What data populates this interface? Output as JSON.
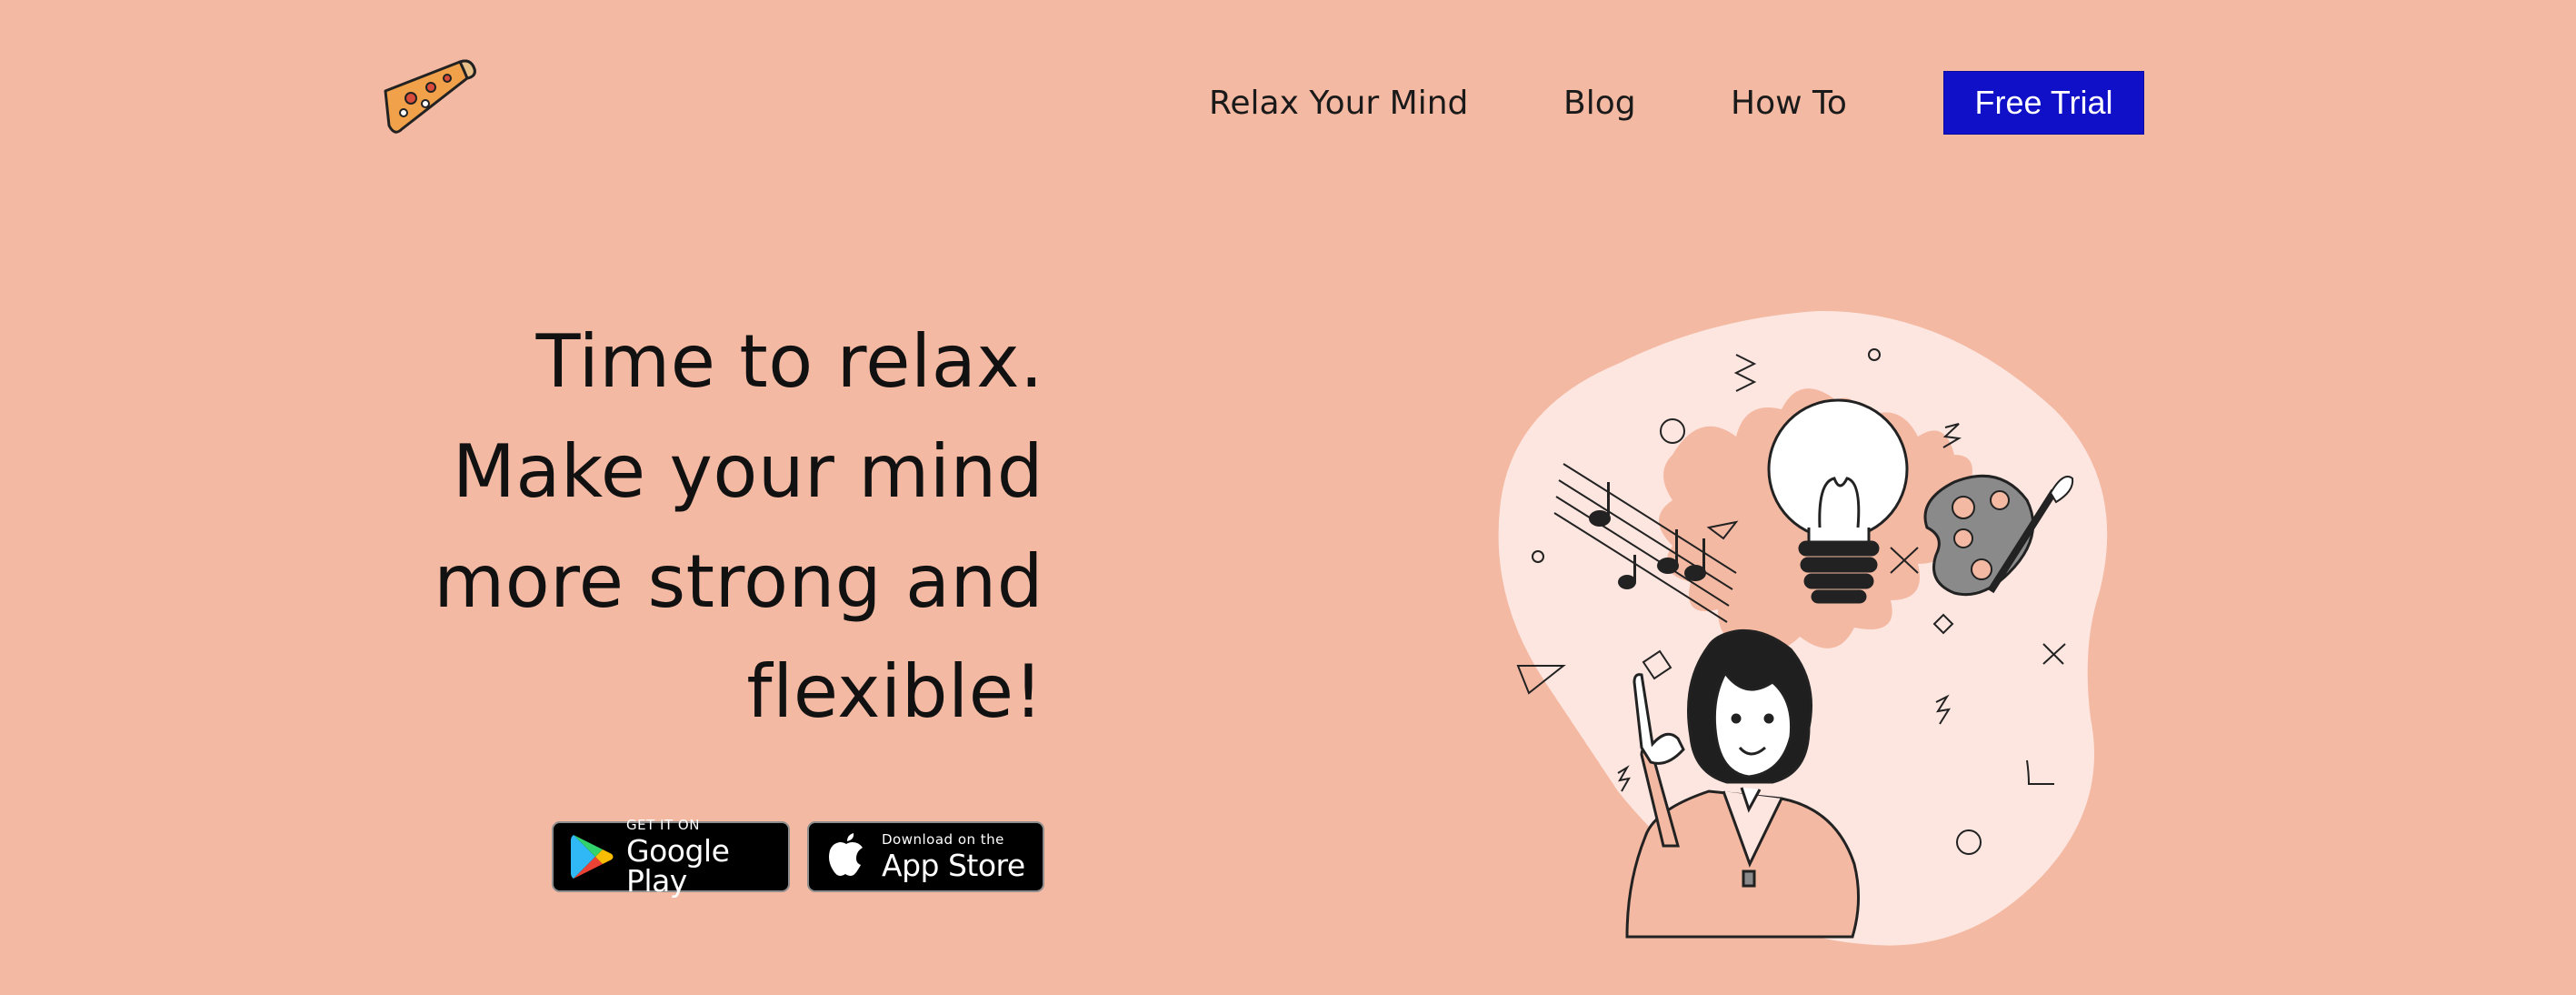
{
  "header": {
    "logo_icon": "pizza-slice-icon",
    "nav": [
      {
        "label": "Relax Your Mind"
      },
      {
        "label": "Blog"
      },
      {
        "label": "How To"
      }
    ],
    "cta_label": "Free Trial"
  },
  "hero": {
    "title_lines": [
      "Time to relax.",
      "Make your mind",
      "more strong and",
      "flexible!"
    ],
    "stores": {
      "google_play": {
        "small": "GET IT ON",
        "big": "Google Play"
      },
      "app_store": {
        "small": "Download on the",
        "big": "App Store"
      }
    },
    "illustration": "woman-with-idea-illustration"
  },
  "colors": {
    "background": "#f4b9a3",
    "cta": "#1010c8",
    "blob": "#fde6e0",
    "splash": "#f4b9a3"
  }
}
